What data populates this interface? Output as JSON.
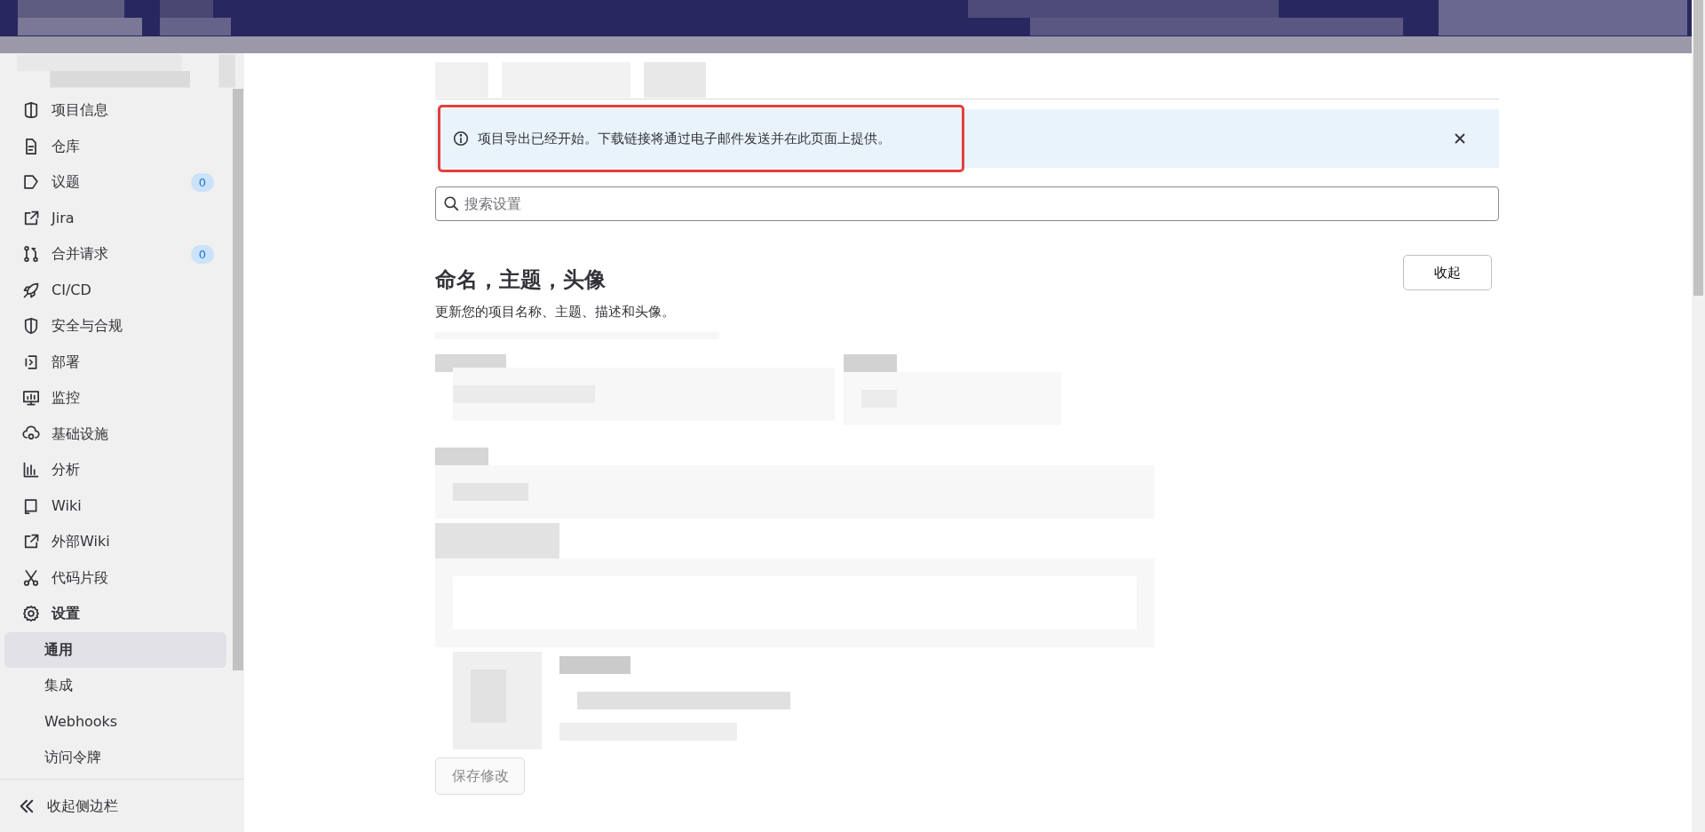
{
  "sidebar": {
    "items": [
      {
        "label": "项目信息",
        "selected": false
      },
      {
        "label": "仓库",
        "selected": false
      },
      {
        "label": "议题",
        "count": "0",
        "selected": false
      },
      {
        "label": "Jira",
        "selected": false
      },
      {
        "label": "合并请求",
        "count": "0",
        "selected": false
      },
      {
        "label": "CI/CD",
        "selected": false
      },
      {
        "label": "安全与合规",
        "selected": false
      },
      {
        "label": "部署",
        "selected": false
      },
      {
        "label": "监控",
        "selected": false
      },
      {
        "label": "基础设施",
        "selected": false
      },
      {
        "label": "分析",
        "selected": false
      },
      {
        "label": "Wiki",
        "selected": false
      },
      {
        "label": "外部Wiki",
        "selected": false
      },
      {
        "label": "代码片段",
        "selected": false
      },
      {
        "label": "设置",
        "selected": false,
        "expanded": true,
        "children": [
          {
            "label": "通用",
            "selected": true
          },
          {
            "label": "集成",
            "selected": false
          },
          {
            "label": "Webhooks",
            "selected": false
          },
          {
            "label": "访问令牌",
            "selected": false
          }
        ]
      }
    ],
    "collapse_label": "收起侧边栏"
  },
  "alert": {
    "message": "项目导出已经开始。下载链接将通过电子邮件发送并在此页面上提供。",
    "highlighted": true,
    "dismissible": true
  },
  "search": {
    "placeholder": "搜索设置"
  },
  "section": {
    "title": "命名，主题，头像",
    "description": "更新您的项目名称、主题、描述和头像。",
    "collapse_button": "收起"
  },
  "save_button": {
    "label": "保存修改",
    "disabled": true
  }
}
